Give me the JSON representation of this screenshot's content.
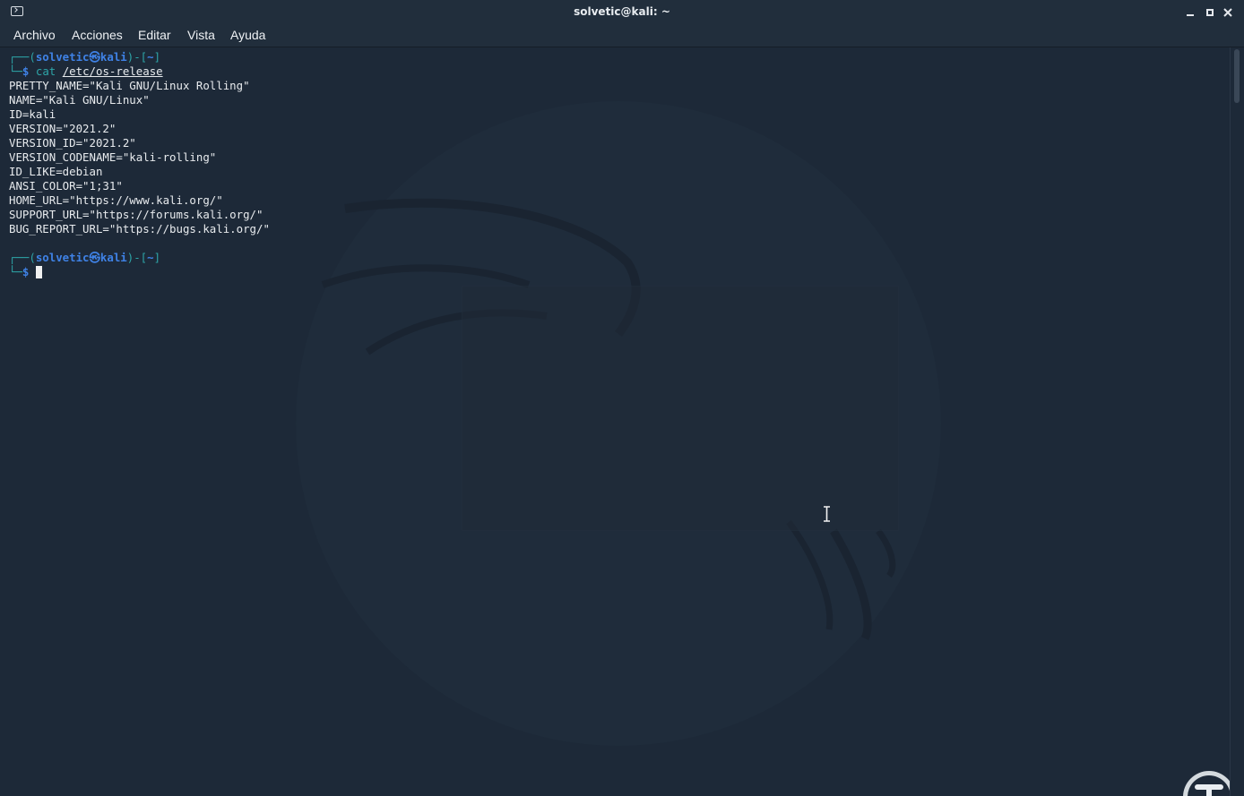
{
  "window": {
    "title": "solvetic@kali: ~"
  },
  "menu": {
    "items": [
      "Archivo",
      "Acciones",
      "Editar",
      "Vista",
      "Ayuda"
    ]
  },
  "terminal": {
    "prompt1": {
      "top_bracket_left": "┌──(",
      "user": "solvetic㉿kali",
      "top_bracket_mid": ")-[",
      "cwd": "~",
      "top_bracket_right": "]",
      "bottom_corner": "└─",
      "dollar": "$",
      "command": "cat",
      "argument": "/etc/os-release"
    },
    "output": [
      "PRETTY_NAME=\"Kali GNU/Linux Rolling\"",
      "NAME=\"Kali GNU/Linux\"",
      "ID=kali",
      "VERSION=\"2021.2\"",
      "VERSION_ID=\"2021.2\"",
      "VERSION_CODENAME=\"kali-rolling\"",
      "ID_LIKE=debian",
      "ANSI_COLOR=\"1;31\"",
      "HOME_URL=\"https://www.kali.org/\"",
      "SUPPORT_URL=\"https://forums.kali.org/\"",
      "BUG_REPORT_URL=\"https://bugs.kali.org/\""
    ],
    "prompt2": {
      "top_bracket_left": "┌──(",
      "user": "solvetic㉿kali",
      "top_bracket_mid": ")-[",
      "cwd": "~",
      "top_bracket_right": "]",
      "bottom_corner": "└─",
      "dollar": "$"
    }
  },
  "colors": {
    "background": "#1d2938",
    "prompt_bracket": "#2da5a8",
    "prompt_user": "#3f82e6",
    "text": "#e8ebee"
  },
  "icons": {
    "window_icon": "terminal-icon",
    "logo": "solvetic-logo-icon"
  }
}
